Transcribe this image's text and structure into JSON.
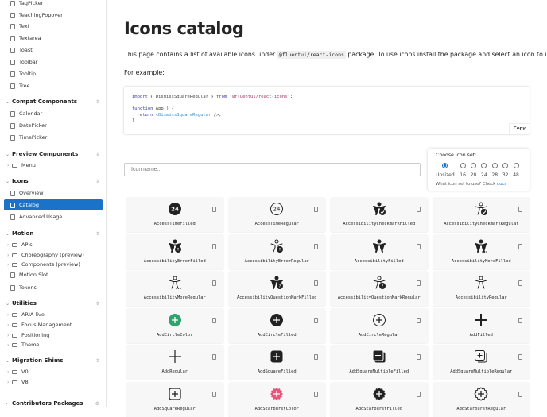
{
  "sidebar": {
    "items": [
      {
        "type": "doc",
        "label": "TagPicker",
        "y": 0
      },
      {
        "type": "doc",
        "label": "TeachingPopover"
      },
      {
        "type": "doc",
        "label": "Text"
      },
      {
        "type": "doc",
        "label": "Textarea"
      },
      {
        "type": "doc",
        "label": "Toast"
      },
      {
        "type": "doc",
        "label": "Toolbar"
      },
      {
        "type": "doc",
        "label": "Tooltip"
      },
      {
        "type": "doc",
        "label": "Tree"
      },
      {
        "type": "header",
        "label": "Compat Components"
      },
      {
        "type": "doc",
        "label": "Calendar"
      },
      {
        "type": "doc",
        "label": "DatePicker"
      },
      {
        "type": "doc",
        "label": "TimePicker"
      },
      {
        "type": "header",
        "label": "Preview Components"
      },
      {
        "type": "folder",
        "label": "Menu"
      },
      {
        "type": "header",
        "label": "Icons"
      },
      {
        "type": "doc",
        "label": "Overview"
      },
      {
        "type": "doc",
        "label": "Catalog",
        "selected": true
      },
      {
        "type": "doc",
        "label": "Advanced Usage"
      },
      {
        "type": "header",
        "label": "Motion"
      },
      {
        "type": "folder",
        "label": "APIs"
      },
      {
        "type": "folder",
        "label": "Choreography (preview)"
      },
      {
        "type": "folder",
        "label": "Components (preview)"
      },
      {
        "type": "doc",
        "label": "Motion Slot"
      },
      {
        "type": "doc",
        "label": "Tokens"
      },
      {
        "type": "header",
        "label": "Utilities"
      },
      {
        "type": "folder",
        "label": "ARIA live"
      },
      {
        "type": "folder",
        "label": "Focus Management"
      },
      {
        "type": "folder",
        "label": "Positioning"
      },
      {
        "type": "folder",
        "label": "Theme"
      },
      {
        "type": "header",
        "label": "Migration Shims"
      },
      {
        "type": "folder",
        "label": "V0"
      },
      {
        "type": "folder",
        "label": "V8"
      },
      {
        "type": "header2",
        "label": "Contributors Packages"
      }
    ]
  },
  "main": {
    "title": "Icons catalog",
    "intro_before": "This page contains a list of available icons under ",
    "intro_code": "@fluentui/react-icons",
    "intro_after": " package. To use icons install the package and select an icon to use.",
    "example_label": "For example:",
    "code": {
      "l1_kw": "import",
      "l1_mid": " { DismissSquareRegular } ",
      "l1_from": "from",
      "l1_str": " '@fluentui/react-icons'",
      "l1_end": ";",
      "l2_kw": "function",
      "l2_rest": " App() {",
      "l3_kw": "  return",
      "l3_tag": " <DismissSquareRegular",
      "l3_end": " />;",
      "l4": "}",
      "copy": "Copy"
    },
    "search_placeholder": "Icon name...",
    "icon_set": {
      "title": "Choose icon set:",
      "options": [
        "Unsized",
        "16",
        "20",
        "24",
        "28",
        "32",
        "48"
      ],
      "selected": "Unsized",
      "hint": "What icon set to use? Check ",
      "hint_link": "docs"
    },
    "icons": [
      {
        "name": "AccessTimeFilled",
        "glyph": "time-filled"
      },
      {
        "name": "AccessTimeRegular",
        "glyph": "time-regular"
      },
      {
        "name": "AccessibilityCheckmarkFilled",
        "glyph": "person-check-f"
      },
      {
        "name": "AccessibilityCheckmarkRegular",
        "glyph": "person-check-r"
      },
      {
        "name": "AccessibilityErrorFilled",
        "glyph": "person-err-f"
      },
      {
        "name": "AccessibilityErrorRegular",
        "glyph": "person-err-r"
      },
      {
        "name": "AccessibilityFilled",
        "glyph": "person-f"
      },
      {
        "name": "AccessibilityMoreFilled",
        "glyph": "person-more-f"
      },
      {
        "name": "AccessibilityMoreRegular",
        "glyph": "person-more-r"
      },
      {
        "name": "AccessibilityQuestionMarkFilled",
        "glyph": "person-q-f"
      },
      {
        "name": "AccessibilityQuestionMarkRegular",
        "glyph": "person-q-r"
      },
      {
        "name": "AccessibilityRegular",
        "glyph": "person-r"
      },
      {
        "name": "AddCircleColor",
        "glyph": "add-circle-color"
      },
      {
        "name": "AddCircleFilled",
        "glyph": "add-circle-f"
      },
      {
        "name": "AddCircleRegular",
        "glyph": "add-circle-r"
      },
      {
        "name": "AddFilled",
        "glyph": "add-f"
      },
      {
        "name": "AddRegular",
        "glyph": "add-r"
      },
      {
        "name": "AddSquareFilled",
        "glyph": "add-square-f"
      },
      {
        "name": "AddSquareMultipleFilled",
        "glyph": "add-sqm-f"
      },
      {
        "name": "AddSquareMultipleRegular",
        "glyph": "add-sqm-r"
      },
      {
        "name": "AddSquareRegular",
        "glyph": "add-square-r"
      },
      {
        "name": "AddStarburstColor",
        "glyph": "star-color"
      },
      {
        "name": "AddStarburstFilled",
        "glyph": "star-f"
      },
      {
        "name": "AddStarburstRegular",
        "glyph": "star-r"
      }
    ]
  },
  "colors": {
    "accent": "#1a73c8",
    "green": "#2fa36b",
    "pink": "#e8557a"
  }
}
